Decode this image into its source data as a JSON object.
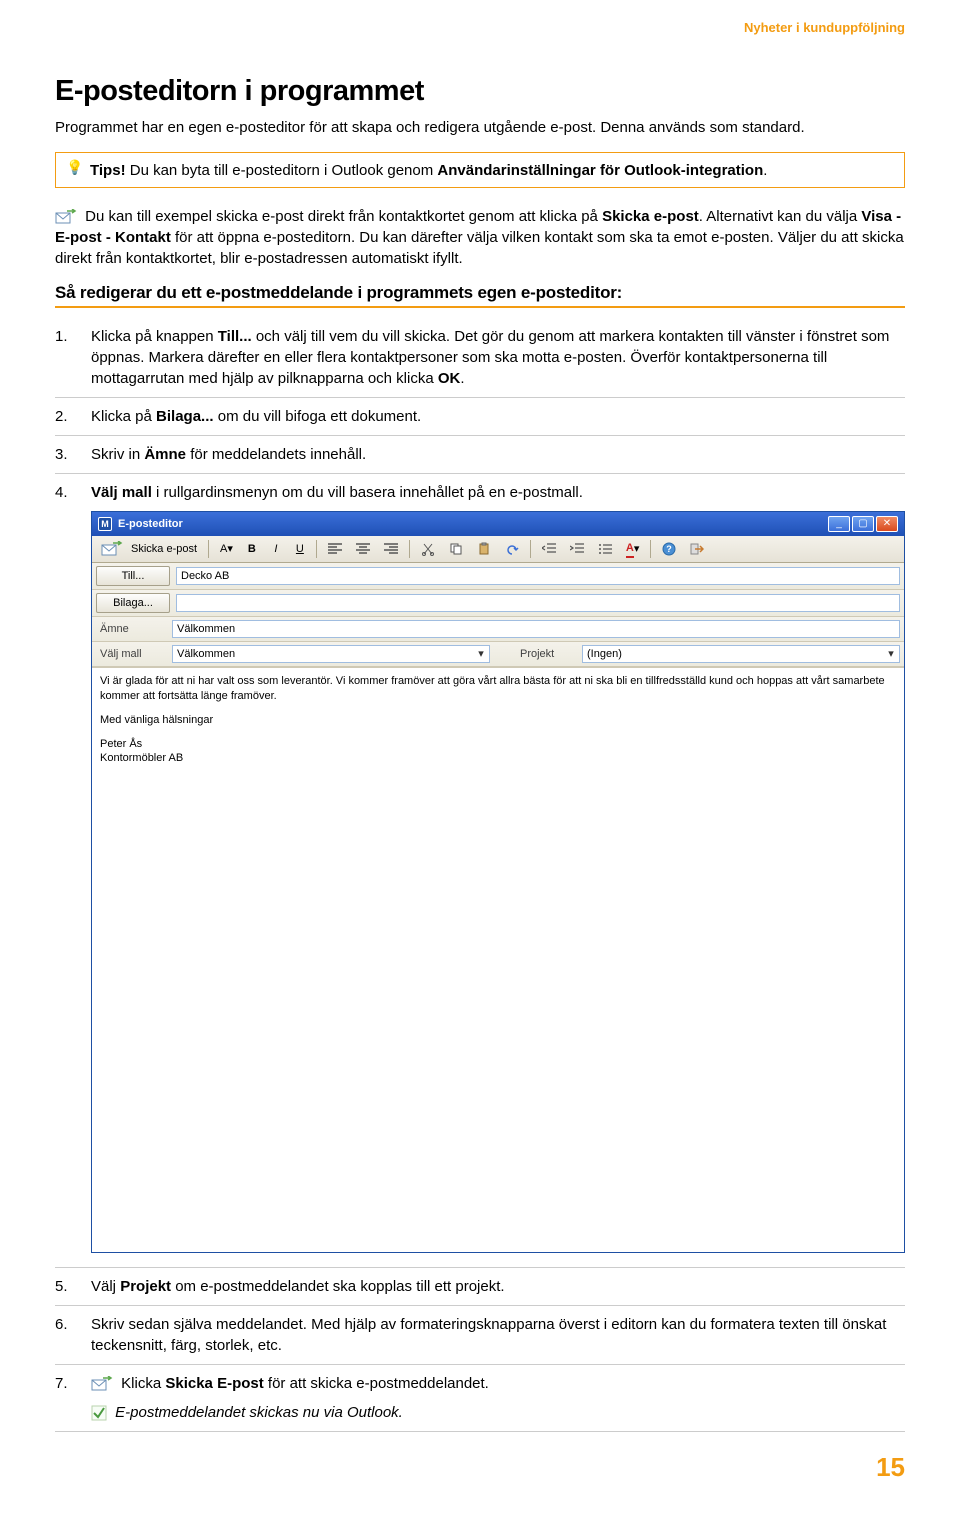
{
  "doc": {
    "section_header": "Nyheter i kunduppföljning",
    "title": "E-posteditorn i programmet",
    "intro": "Programmet har en egen e-posteditor för att skapa och redigera utgående e-post. Denna används som standard.",
    "tip_prefix": "Tips! ",
    "tip_text1": "Du kan byta till e-posteditorn i Outlook genom ",
    "tip_bold": "Användarinställningar för Outlook-integration",
    "tip_suffix": ".",
    "para2_a": "Du kan till exempel skicka e-post direkt från kontaktkortet genom att klicka på ",
    "para2_bold1": "Skicka e-post",
    "para2_b": ". Alternativt kan du välja ",
    "para2_bold2": "Visa - E-post - Kontakt",
    "para2_c": " för att öppna e-posteditorn. Du kan därefter välja vilken kontakt som ska ta emot e-posten. Väljer du att skicka direkt från kontaktkortet, blir e-postadressen automatiskt ifyllt.",
    "h2": "Så redigerar du ett e-postmeddelande i programmets egen e-posteditor:",
    "steps": {
      "1": {
        "a": "Klicka på knappen ",
        "b1": "Till...",
        "c": " och välj till vem du vill skicka. Det gör du genom att markera kontakten till vänster i fönstret som öppnas. Markera därefter en eller flera kontaktpersoner som ska motta e-posten. Överför kontaktpersonerna till mottagarrutan med hjälp av pilknapparna och klicka ",
        "b2": "OK",
        "d": "."
      },
      "2": {
        "a": "Klicka på ",
        "b1": "Bilaga...",
        "c": " om du vill bifoga ett dokument."
      },
      "3": {
        "a": "Skriv in ",
        "b1": "Ämne",
        "c": " för meddelandets innehåll."
      },
      "4": {
        "a": "",
        "b1": "Välj mall",
        "c": " i rullgardinsmenyn om du vill basera innehållet på en e-postmall."
      },
      "5": {
        "a": "Välj ",
        "b1": "Projekt",
        "c": " om e-postmeddelandet ska kopplas till ett projekt."
      },
      "6": {
        "a": "Skriv sedan själva meddelandet. Med hjälp av formateringsknapparna överst i editorn kan du formatera texten till önskat teckensnitt, färg, storlek, etc."
      },
      "7": {
        "a": "Klicka ",
        "b1": "Skicka E-post",
        "c": " för att skicka e-postmeddelandet.",
        "note": "E-postmeddelandet skickas nu via Outlook."
      }
    },
    "page_number": "15"
  },
  "editor": {
    "app_icon_letter": "M",
    "title": "E-posteditor",
    "send_label": "Skicka e-post",
    "font_dropdown": "A",
    "to_button": "Till...",
    "to_value": "Decko AB",
    "attach_button": "Bilaga...",
    "subject_label": "Ämne",
    "subject_value": "Välkommen",
    "template_label": "Välj mall",
    "template_value": "Välkommen",
    "project_label": "Projekt",
    "project_value": "(Ingen)",
    "body_para": "Vi är glada för att ni har valt oss som leverantör. Vi kommer framöver att göra vårt allra bästa för att ni ska bli en tillfredsställd kund och hoppas att vårt samarbete kommer att fortsätta länge framöver.",
    "body_sign1": "Med vänliga hälsningar",
    "body_sign2": "Peter Ås",
    "body_sign3": "Kontormöbler AB"
  }
}
